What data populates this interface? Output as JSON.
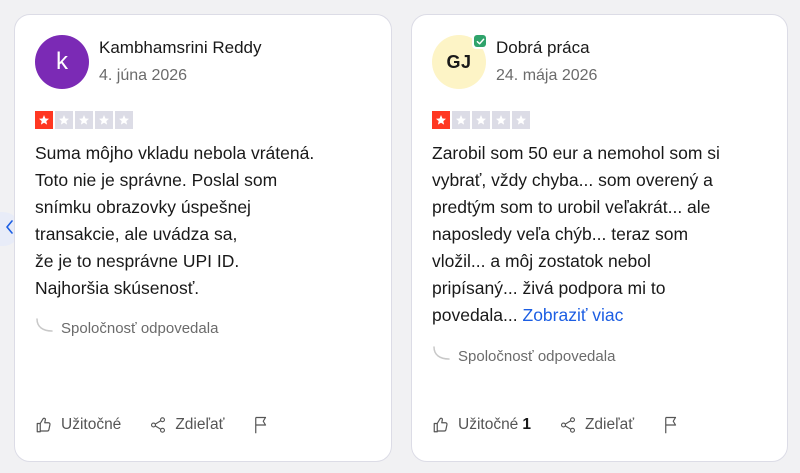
{
  "colors": {
    "star_filled": "#ff3722",
    "star_empty": "#dcdce6",
    "link": "#1c5ee3",
    "avatar_1_bg": "#7b2ab5",
    "avatar_2_bg": "#fdf4c6",
    "verified": "#2fa36b"
  },
  "navigation": {
    "prev_icon": "chevron-left-icon"
  },
  "reviews": [
    {
      "avatar_text": "k",
      "author": "Kambhamsrini Reddy",
      "date": "4. júna 2026",
      "rating": 1,
      "max_rating": 5,
      "verified": false,
      "body_lines": [
        "Suma môjho vkladu nebola vrátená.",
        "Toto nie je správne. Poslal som",
        "snímku obrazovky úspešnej",
        "transakcie, ale uvádza sa,",
        "že je to nesprávne UPI ID.",
        "Najhoršia skúsenosť."
      ],
      "reply_label": "Spoločnosť odpovedala",
      "actions": {
        "useful": "Užitočné",
        "useful_count": "",
        "share": "Zdieľať"
      }
    },
    {
      "avatar_text": "GJ",
      "author": "Dobrá práca",
      "date": "24. mája 2026",
      "rating": 1,
      "max_rating": 5,
      "verified": true,
      "body_lines": [
        "Zarobil som 50 eur a nemohol som si",
        "vybrať, vždy chyba... som overený a",
        "predtým som to urobil veľakrát... ale",
        "naposledy veľa chýb... teraz som",
        "vložil... a môj zostatok nebol",
        "pripísaný... živá podpora mi to",
        "povedala..."
      ],
      "more_link": "Zobraziť viac",
      "reply_label": "Spoločnosť odpovedala",
      "actions": {
        "useful": "Užitočné",
        "useful_count": "1",
        "share": "Zdieľať"
      }
    }
  ]
}
